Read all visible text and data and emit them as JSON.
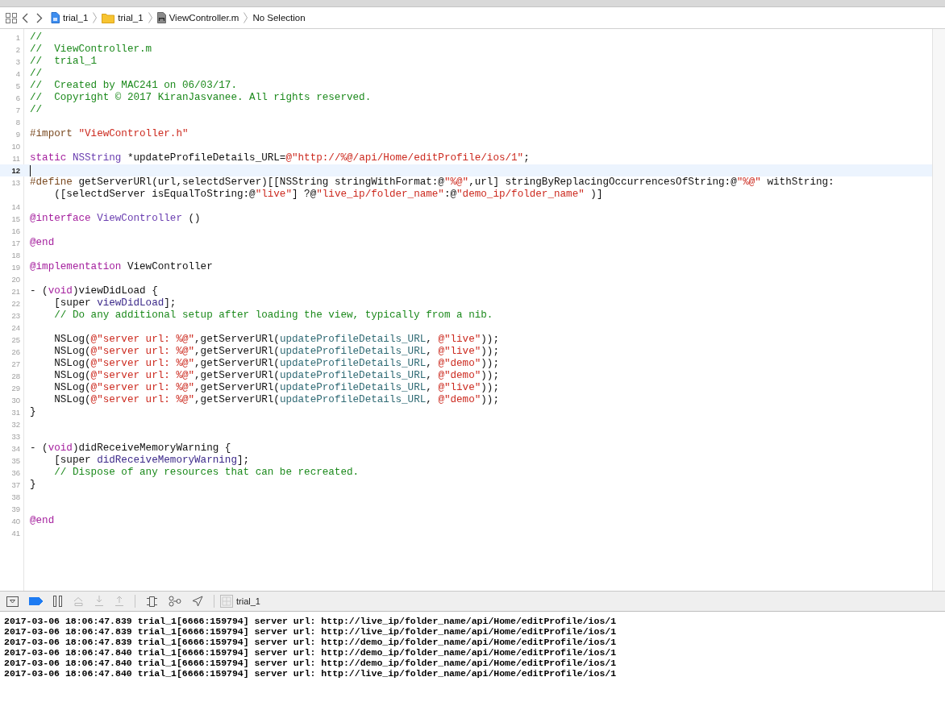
{
  "jump_bar": {
    "breadcrumbs": [
      {
        "label": "trial_1",
        "kind": "project"
      },
      {
        "label": "trial_1",
        "kind": "folder"
      },
      {
        "label": "ViewController.m",
        "kind": "source"
      },
      {
        "label": "No Selection",
        "kind": "selection"
      }
    ]
  },
  "editor": {
    "lines": [
      {
        "number": "1",
        "current": false,
        "tokens": [
          {
            "text": "//",
            "kind": "comment"
          }
        ]
      },
      {
        "number": "2",
        "current": false,
        "tokens": [
          {
            "text": "//  ViewController.m",
            "kind": "comment"
          }
        ]
      },
      {
        "number": "3",
        "current": false,
        "tokens": [
          {
            "text": "//  trial_1",
            "kind": "comment"
          }
        ]
      },
      {
        "number": "4",
        "current": false,
        "tokens": [
          {
            "text": "//",
            "kind": "comment"
          }
        ]
      },
      {
        "number": "5",
        "current": false,
        "tokens": [
          {
            "text": "//  Created by MAC241 on 06/03/17.",
            "kind": "comment"
          }
        ]
      },
      {
        "number": "6",
        "current": false,
        "tokens": [
          {
            "text": "//  Copyright © 2017 KiranJasvanee. All rights reserved.",
            "kind": "comment"
          }
        ]
      },
      {
        "number": "7",
        "current": false,
        "tokens": [
          {
            "text": "//",
            "kind": "comment"
          }
        ]
      },
      {
        "number": "8",
        "current": false
      },
      {
        "number": "9",
        "current": false,
        "tokens": [
          {
            "text": "#import ",
            "kind": "preprocessor"
          },
          {
            "text": "\"ViewController.h\"",
            "kind": "string"
          }
        ]
      },
      {
        "number": "10",
        "current": false
      },
      {
        "number": "11",
        "current": false,
        "tokens": [
          {
            "text": "static ",
            "kind": "keyword"
          },
          {
            "text": "NSString",
            "kind": "type"
          },
          {
            "text": " *updateProfileDetails_URL=",
            "kind": "plain"
          },
          {
            "text": "@\"http://%@/api/Home/editProfile/ios/1\"",
            "kind": "string"
          },
          {
            "text": ";",
            "kind": "plain"
          }
        ]
      },
      {
        "number": "12",
        "current": true
      },
      {
        "number": "13",
        "current": false,
        "tokens": [
          {
            "text": "#define",
            "kind": "preprocessor"
          },
          {
            "text": " getServerURl(url,selectdServer)[[NSString stringWithFormat:@",
            "kind": "plain"
          },
          {
            "text": "\"%@\"",
            "kind": "string"
          },
          {
            "text": ",url] stringByReplacingOccurrencesOfString:@",
            "kind": "plain"
          },
          {
            "text": "\"%@\"",
            "kind": "string"
          },
          {
            "text": " withString:",
            "kind": "plain"
          }
        ],
        "continuation": [
          {
            "text": "([selectdServer isEqualToString:@",
            "kind": "plain"
          },
          {
            "text": "\"live\"",
            "kind": "string"
          },
          {
            "text": "] ?@",
            "kind": "plain"
          },
          {
            "text": "\"live_ip/folder_name\"",
            "kind": "string"
          },
          {
            "text": ":@",
            "kind": "plain"
          },
          {
            "text": "\"demo_ip/folder_name\"",
            "kind": "string"
          },
          {
            "text": " )]",
            "kind": "plain"
          }
        ]
      },
      {
        "number": "14",
        "current": false
      },
      {
        "number": "15",
        "current": false,
        "tokens": [
          {
            "text": "@interface ",
            "kind": "keyword"
          },
          {
            "text": "ViewController",
            "kind": "type"
          },
          {
            "text": " ()",
            "kind": "plain"
          }
        ]
      },
      {
        "number": "16",
        "current": false
      },
      {
        "number": "17",
        "current": false,
        "tokens": [
          {
            "text": "@end",
            "kind": "keyword"
          }
        ]
      },
      {
        "number": "18",
        "current": false
      },
      {
        "number": "19",
        "current": false,
        "tokens": [
          {
            "text": "@implementation",
            "kind": "keyword"
          },
          {
            "text": " ViewController",
            "kind": "plain"
          }
        ]
      },
      {
        "number": "20",
        "current": false
      },
      {
        "number": "21",
        "current": false,
        "tokens": [
          {
            "text": "- (",
            "kind": "plain"
          },
          {
            "text": "void",
            "kind": "keyword"
          },
          {
            "text": ")viewDidLoad {",
            "kind": "plain"
          }
        ]
      },
      {
        "number": "22",
        "current": false,
        "tokens": [
          {
            "text": "    [super ",
            "kind": "plain"
          },
          {
            "text": "viewDidLoad",
            "kind": "method"
          },
          {
            "text": "];",
            "kind": "plain"
          }
        ]
      },
      {
        "number": "23",
        "current": false,
        "tokens": [
          {
            "text": "    // Do any additional setup after loading the view, typically from a nib.",
            "kind": "comment"
          }
        ]
      },
      {
        "number": "24",
        "current": false
      },
      {
        "number": "25",
        "current": false,
        "tokens": [
          {
            "text": "    NSLog(",
            "kind": "plain"
          },
          {
            "text": "@\"server url: %@\"",
            "kind": "string"
          },
          {
            "text": ",getServerURl(",
            "kind": "plain"
          },
          {
            "text": "updateProfileDetails_URL",
            "kind": "variable"
          },
          {
            "text": ", ",
            "kind": "plain"
          },
          {
            "text": "@\"live\"",
            "kind": "string"
          },
          {
            "text": "));",
            "kind": "plain"
          }
        ]
      },
      {
        "number": "26",
        "current": false,
        "tokens": [
          {
            "text": "    NSLog(",
            "kind": "plain"
          },
          {
            "text": "@\"server url: %@\"",
            "kind": "string"
          },
          {
            "text": ",getServerURl(",
            "kind": "plain"
          },
          {
            "text": "updateProfileDetails_URL",
            "kind": "variable"
          },
          {
            "text": ", ",
            "kind": "plain"
          },
          {
            "text": "@\"live\"",
            "kind": "string"
          },
          {
            "text": "));",
            "kind": "plain"
          }
        ]
      },
      {
        "number": "27",
        "current": false,
        "tokens": [
          {
            "text": "    NSLog(",
            "kind": "plain"
          },
          {
            "text": "@\"server url: %@\"",
            "kind": "string"
          },
          {
            "text": ",getServerURl(",
            "kind": "plain"
          },
          {
            "text": "updateProfileDetails_URL",
            "kind": "variable"
          },
          {
            "text": ", ",
            "kind": "plain"
          },
          {
            "text": "@\"demo\"",
            "kind": "string"
          },
          {
            "text": "));",
            "kind": "plain"
          }
        ]
      },
      {
        "number": "28",
        "current": false,
        "tokens": [
          {
            "text": "    NSLog(",
            "kind": "plain"
          },
          {
            "text": "@\"server url: %@\"",
            "kind": "string"
          },
          {
            "text": ",getServerURl(",
            "kind": "plain"
          },
          {
            "text": "updateProfileDetails_URL",
            "kind": "variable"
          },
          {
            "text": ", ",
            "kind": "plain"
          },
          {
            "text": "@\"demo\"",
            "kind": "string"
          },
          {
            "text": "));",
            "kind": "plain"
          }
        ]
      },
      {
        "number": "29",
        "current": false,
        "tokens": [
          {
            "text": "    NSLog(",
            "kind": "plain"
          },
          {
            "text": "@\"server url: %@\"",
            "kind": "string"
          },
          {
            "text": ",getServerURl(",
            "kind": "plain"
          },
          {
            "text": "updateProfileDetails_URL",
            "kind": "variable"
          },
          {
            "text": ", ",
            "kind": "plain"
          },
          {
            "text": "@\"live\"",
            "kind": "string"
          },
          {
            "text": "));",
            "kind": "plain"
          }
        ]
      },
      {
        "number": "30",
        "current": false,
        "tokens": [
          {
            "text": "    NSLog(",
            "kind": "plain"
          },
          {
            "text": "@\"server url: %@\"",
            "kind": "string"
          },
          {
            "text": ",getServerURl(",
            "kind": "plain"
          },
          {
            "text": "updateProfileDetails_URL",
            "kind": "variable"
          },
          {
            "text": ", ",
            "kind": "plain"
          },
          {
            "text": "@\"demo\"",
            "kind": "string"
          },
          {
            "text": "));",
            "kind": "plain"
          }
        ]
      },
      {
        "number": "31",
        "current": false,
        "tokens": [
          {
            "text": "}",
            "kind": "plain"
          }
        ]
      },
      {
        "number": "32",
        "current": false
      },
      {
        "number": "33",
        "current": false
      },
      {
        "number": "34",
        "current": false,
        "tokens": [
          {
            "text": "- (",
            "kind": "plain"
          },
          {
            "text": "void",
            "kind": "keyword"
          },
          {
            "text": ")didReceiveMemoryWarning {",
            "kind": "plain"
          }
        ]
      },
      {
        "number": "35",
        "current": false,
        "tokens": [
          {
            "text": "    [super ",
            "kind": "plain"
          },
          {
            "text": "didReceiveMemoryWarning",
            "kind": "method"
          },
          {
            "text": "];",
            "kind": "plain"
          }
        ]
      },
      {
        "number": "36",
        "current": false,
        "tokens": [
          {
            "text": "    // Dispose of any resources that can be recreated.",
            "kind": "comment"
          }
        ]
      },
      {
        "number": "37",
        "current": false,
        "tokens": [
          {
            "text": "}",
            "kind": "plain"
          }
        ]
      },
      {
        "number": "38",
        "current": false
      },
      {
        "number": "39",
        "current": false
      },
      {
        "number": "40",
        "current": false,
        "tokens": [
          {
            "text": "@end",
            "kind": "keyword"
          }
        ]
      },
      {
        "number": "41",
        "current": false
      }
    ]
  },
  "debug_bar": {
    "breakpoints_active": true,
    "stepping_enabled": false,
    "process": "trial_1"
  },
  "console": {
    "lines": [
      "2017-03-06 18:06:47.839 trial_1[6666:159794] server url: http://live_ip/folder_name/api/Home/editProfile/ios/1",
      "2017-03-06 18:06:47.839 trial_1[6666:159794] server url: http://live_ip/folder_name/api/Home/editProfile/ios/1",
      "2017-03-06 18:06:47.839 trial_1[6666:159794] server url: http://demo_ip/folder_name/api/Home/editProfile/ios/1",
      "2017-03-06 18:06:47.840 trial_1[6666:159794] server url: http://demo_ip/folder_name/api/Home/editProfile/ios/1",
      "2017-03-06 18:06:47.840 trial_1[6666:159794] server url: http://demo_ip/folder_name/api/Home/editProfile/ios/1",
      "2017-03-06 18:06:47.840 trial_1[6666:159794] server url: http://live_ip/folder_name/api/Home/editProfile/ios/1"
    ]
  }
}
